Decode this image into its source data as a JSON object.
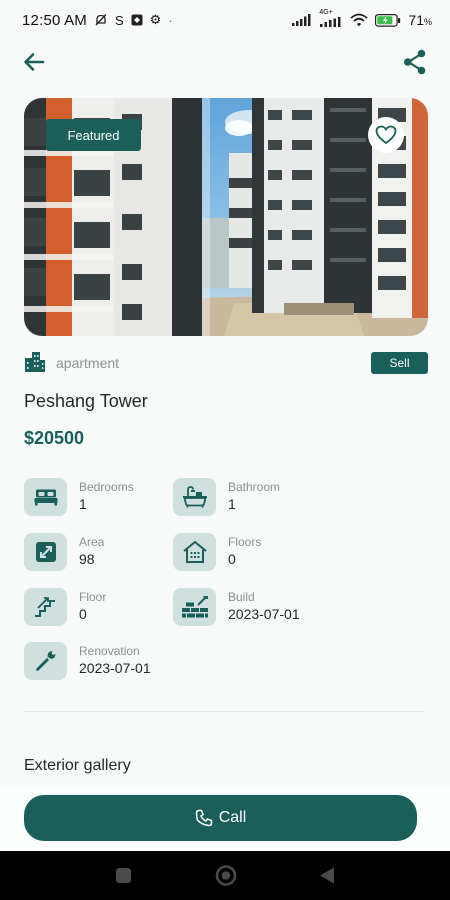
{
  "status_bar": {
    "time": "12:50 AM",
    "battery": "71",
    "battery_unit": "%",
    "net_label": "4G+"
  },
  "property": {
    "featured_label": "Featured",
    "type": "apartment",
    "deal_label": "Sell",
    "title": "Peshang Tower",
    "price": "$20500"
  },
  "specs": [
    {
      "label": "Bedrooms",
      "value": "1",
      "icon": "bed-icon"
    },
    {
      "label": "Bathroom",
      "value": "1",
      "icon": "bathtub-icon"
    },
    {
      "label": "Area",
      "value": "98",
      "icon": "expand-icon"
    },
    {
      "label": "Floors",
      "value": "0",
      "icon": "house-icon"
    },
    {
      "label": "Floor",
      "value": "0",
      "icon": "stairs-icon"
    },
    {
      "label": "Build",
      "value": "2023-07-01",
      "icon": "brick-wall-icon"
    },
    {
      "label": "Renovation",
      "value": "2023-07-01",
      "icon": "wrench-icon"
    }
  ],
  "gallery": {
    "title": "Exterior gallery"
  },
  "actions": {
    "call_label": "Call"
  },
  "colors": {
    "primary": "#1a5f5a",
    "icon_bg": "#cfe0df",
    "background": "#f8f9f9"
  }
}
